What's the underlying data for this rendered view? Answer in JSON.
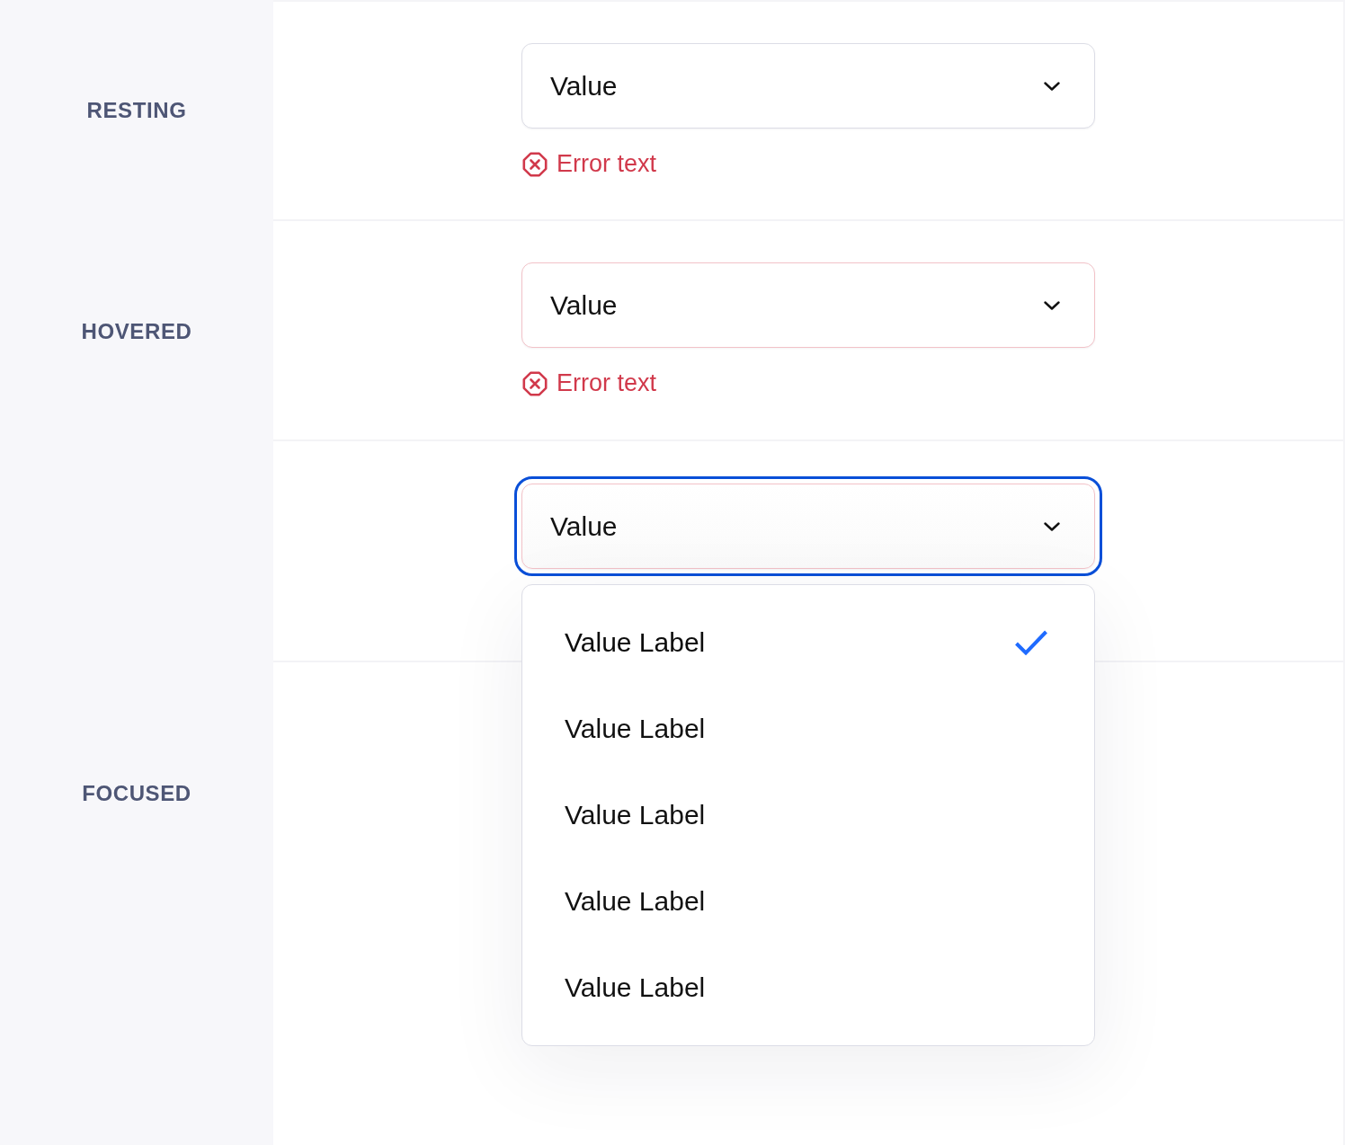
{
  "rows": [
    {
      "label": "RESTING",
      "kind": "resting",
      "select": {
        "value": "Value"
      },
      "error": "Error text"
    },
    {
      "label": "HOVERED",
      "kind": "hovered",
      "select": {
        "value": "Value"
      },
      "error": "Error text"
    },
    {
      "label": "FOCUSED",
      "kind": "focused",
      "select": {
        "value": "Value",
        "options": [
          {
            "label": "Value Label",
            "selected": true
          },
          {
            "label": "Value Label",
            "selected": false
          },
          {
            "label": "Value Label",
            "selected": false
          },
          {
            "label": "Value Label",
            "selected": false
          },
          {
            "label": "Value Label",
            "selected": false
          }
        ]
      }
    }
  ]
}
